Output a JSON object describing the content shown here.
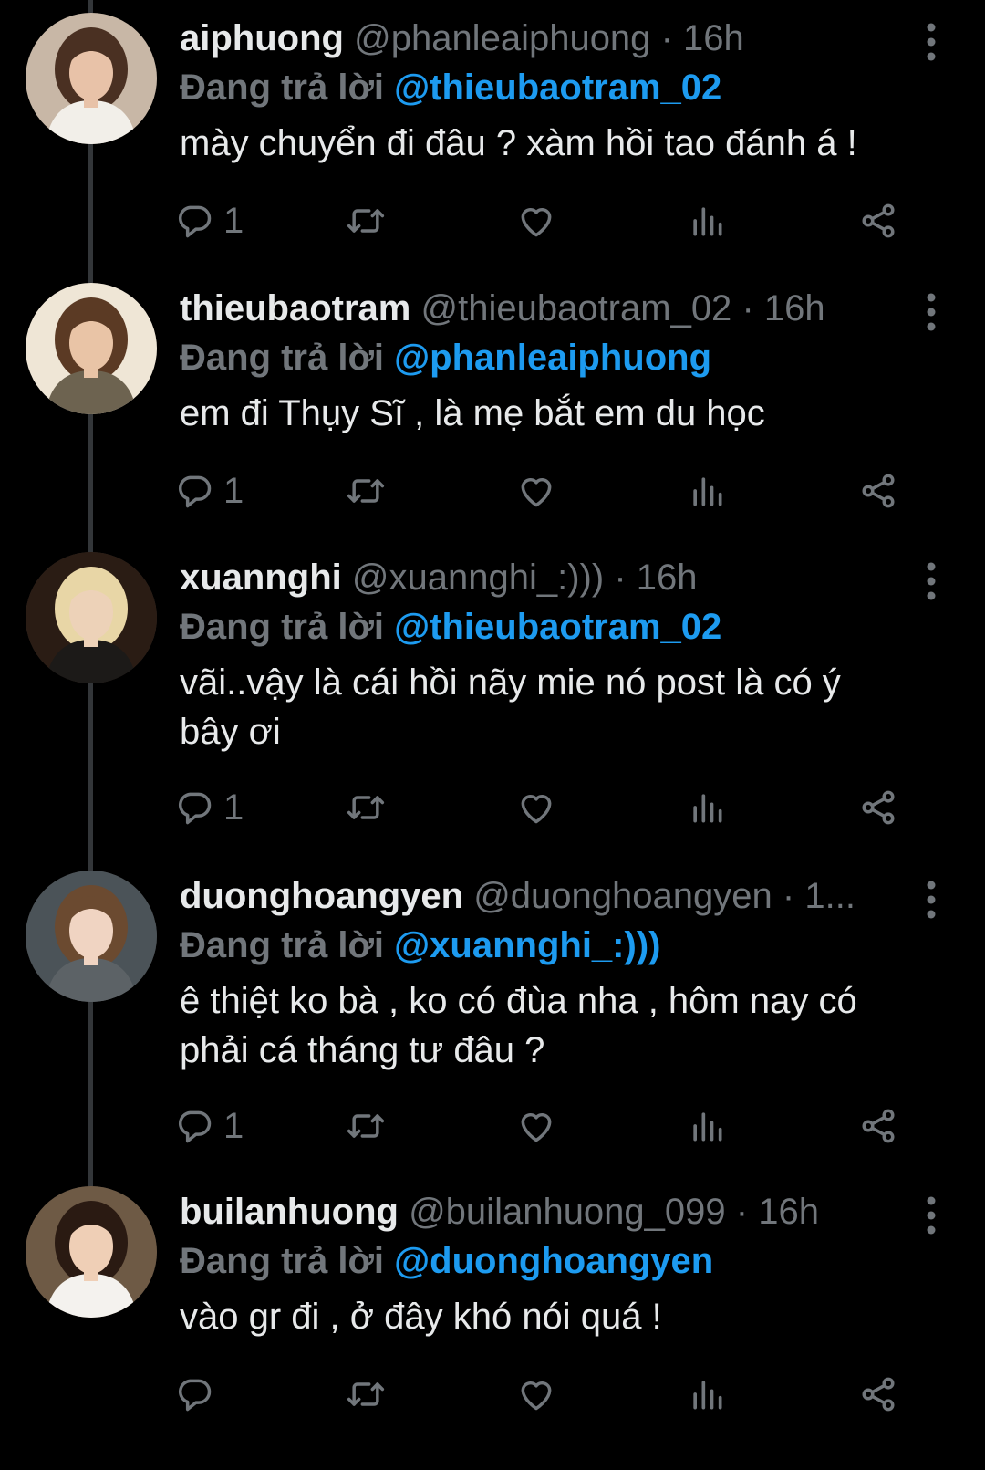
{
  "thread": {
    "reply_prefix": "Đang trả lời",
    "separator": "·"
  },
  "tweets": [
    {
      "name": "aiphuong",
      "handle": "@phanleaiphuong",
      "time": "16h",
      "reply_to": "@thieubaotram_02",
      "text_lines": [
        "mày chuyển đi đâu ? xàm hồi tao đánh á !"
      ],
      "reply_count": "1",
      "avatar_colors": {
        "bg": "#c8b7a6",
        "hair": "#4a3022",
        "skin": "#e8c2a8",
        "cloth": "#f2efe9"
      }
    },
    {
      "name": "thieubaotram",
      "handle": "@thieubaotram_02",
      "time": "16h",
      "reply_to": "@phanleaiphuong",
      "text_lines": [
        "em đi Thụy Sĩ , là mẹ bắt em du học"
      ],
      "reply_count": "1",
      "avatar_colors": {
        "bg": "#efe6d6",
        "hair": "#5b3a24",
        "skin": "#e9c4a6",
        "cloth": "#6d6350"
      }
    },
    {
      "name": "xuannghi",
      "handle": "@xuannghi_:)))",
      "time": "16h",
      "reply_to": "@thieubaotram_02",
      "text_lines": [
        "vãi..vậy là cái hồi nãy mie nó post là có ý",
        "bây ơi"
      ],
      "reply_count": "1",
      "avatar_colors": {
        "bg": "#2a1c14",
        "hair": "#e8d6a6",
        "skin": "#edd2b8",
        "cloth": "#1c1a18"
      }
    },
    {
      "name": "duonghoangyen",
      "handle": "@duonghoangyen",
      "time": "1...",
      "reply_to": "@xuannghi_:)))",
      "text_lines": [
        "ê thiệt ko bà , ko có đùa nha , hôm nay có",
        "phải cá tháng tư đâu ?"
      ],
      "reply_count": "1",
      "avatar_colors": {
        "bg": "#4b5358",
        "hair": "#6b4a30",
        "skin": "#f0d4c2",
        "cloth": "#5c6266"
      }
    },
    {
      "name": "builanhuong",
      "handle": "@builanhuong_099",
      "time": "16h",
      "reply_to": "@duonghoangyen",
      "text_lines": [
        "vào gr đi , ở đây khó nói quá !"
      ],
      "reply_count": "",
      "avatar_colors": {
        "bg": "#6e5a45",
        "hair": "#2a1a12",
        "skin": "#efcfb6",
        "cloth": "#f4f2ee"
      }
    }
  ],
  "icons": {
    "reply": "reply-icon",
    "retweet": "retweet-icon",
    "like": "heart-icon",
    "views": "views-icon",
    "share": "share-icon",
    "more": "more-vertical-icon"
  },
  "colors": {
    "background": "#000000",
    "text": "#e7e9ea",
    "muted": "#71767b",
    "mention": "#1d9bf0",
    "thread_line": "#333639"
  }
}
